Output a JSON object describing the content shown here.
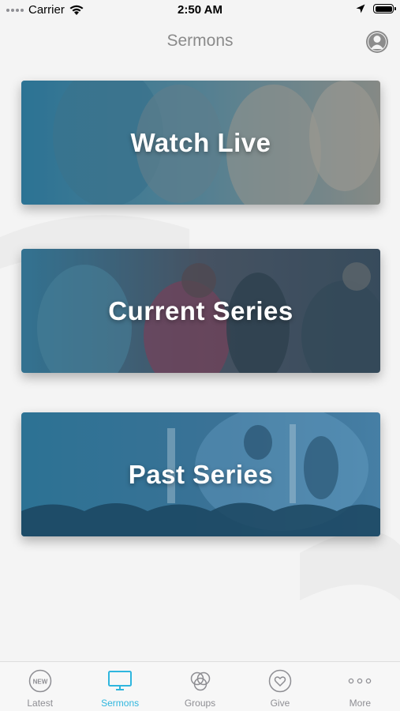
{
  "status_bar": {
    "carrier": "Carrier",
    "time": "2:50 AM",
    "icons": [
      "signal-dots-icon",
      "wifi-icon",
      "location-arrow-icon",
      "battery-icon"
    ]
  },
  "nav": {
    "title": "Sermons",
    "profile_icon": "profile-avatar-icon"
  },
  "cards": [
    {
      "title": "Watch Live"
    },
    {
      "title": "Current Series"
    },
    {
      "title": "Past Series"
    }
  ],
  "tabs": [
    {
      "label": "Latest",
      "icon": "new-badge-icon",
      "active": false
    },
    {
      "label": "Sermons",
      "icon": "tv-icon",
      "active": true
    },
    {
      "label": "Groups",
      "icon": "groups-circles-icon",
      "active": false
    },
    {
      "label": "Give",
      "icon": "heart-icon",
      "active": false
    },
    {
      "label": "More",
      "icon": "more-dots-icon",
      "active": false
    }
  ],
  "colors": {
    "accent": "#2fb6de",
    "card_tint": "#2d7fa3",
    "background": "#f4f4f4",
    "tab_inactive": "#8e8e93"
  }
}
